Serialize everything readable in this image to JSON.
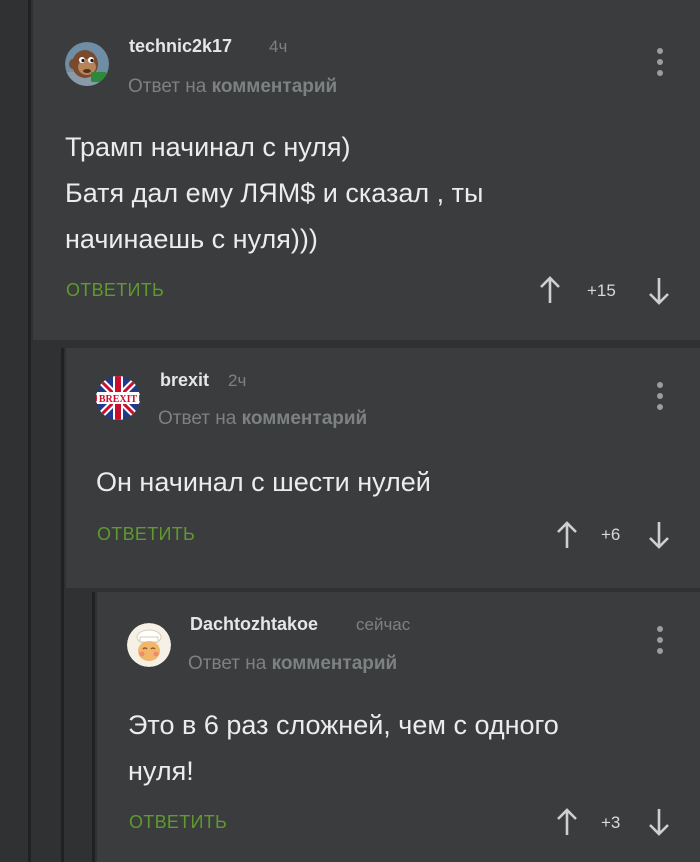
{
  "comments": [
    {
      "username": "technic2k17",
      "time": "4ч",
      "reply_prefix": "Ответ на",
      "reply_target": "комментарий",
      "lines": [
        "Трамп начинал с нуля)",
        "Батя дал ему ЛЯМ$ и сказал , ты",
        "начинаешь с нуля)))"
      ],
      "reply_label": "ОТВЕТИТЬ",
      "score": "+15",
      "avatar_icon": "monkey-puppet-avatar-icon"
    },
    {
      "username": "brexit",
      "time": "2ч",
      "reply_prefix": "Ответ на",
      "reply_target": "комментарий",
      "lines": [
        "Он начинал с шести нулей"
      ],
      "reply_label": "ОТВЕТИТЬ",
      "score": "+6",
      "avatar_icon": "brexit-flag-avatar-icon",
      "avatar_text": "BREXIT"
    },
    {
      "username": "Dachtozhtakoe",
      "time": "сейчас",
      "reply_prefix": "Ответ на",
      "reply_target": "комментарий",
      "lines": [
        "Это в 6 раз сложней, чем с одного",
        "нуля!"
      ],
      "reply_label": "ОТВЕТИТЬ",
      "score": "+3",
      "avatar_icon": "chef-avatar-icon"
    }
  ],
  "colors": {
    "background": "#2f3132",
    "comment_bg": "#3a3c3d",
    "reply_green": "#5f9a2f",
    "text": "#ececec",
    "muted": "#7e8182"
  }
}
